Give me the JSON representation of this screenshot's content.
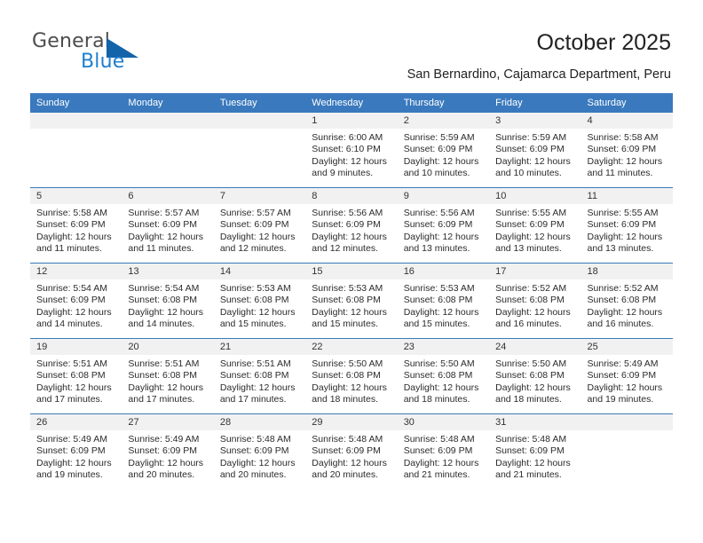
{
  "brand": {
    "name_top": "General",
    "name_bottom": "Blue",
    "accent_color": "#1464aa",
    "text_color": "#4d4d4d"
  },
  "header": {
    "title": "October 2025",
    "subtitle": "San Bernardino, Cajamarca Department, Peru"
  },
  "theme": {
    "header_band": "#3a79bd",
    "date_band": "#f1f1f1",
    "row_separator": "#3a79bd",
    "page_background": "#ffffff"
  },
  "calendar": {
    "weekday_headers": [
      "Sunday",
      "Monday",
      "Tuesday",
      "Wednesday",
      "Thursday",
      "Friday",
      "Saturday"
    ],
    "weeks": [
      [
        {
          "day": "",
          "sunrise": "",
          "sunset": "",
          "daylight_1": "",
          "daylight_2": ""
        },
        {
          "day": "",
          "sunrise": "",
          "sunset": "",
          "daylight_1": "",
          "daylight_2": ""
        },
        {
          "day": "",
          "sunrise": "",
          "sunset": "",
          "daylight_1": "",
          "daylight_2": ""
        },
        {
          "day": "1",
          "sunrise": "Sunrise: 6:00 AM",
          "sunset": "Sunset: 6:10 PM",
          "daylight_1": "Daylight: 12 hours",
          "daylight_2": "and 9 minutes."
        },
        {
          "day": "2",
          "sunrise": "Sunrise: 5:59 AM",
          "sunset": "Sunset: 6:09 PM",
          "daylight_1": "Daylight: 12 hours",
          "daylight_2": "and 10 minutes."
        },
        {
          "day": "3",
          "sunrise": "Sunrise: 5:59 AM",
          "sunset": "Sunset: 6:09 PM",
          "daylight_1": "Daylight: 12 hours",
          "daylight_2": "and 10 minutes."
        },
        {
          "day": "4",
          "sunrise": "Sunrise: 5:58 AM",
          "sunset": "Sunset: 6:09 PM",
          "daylight_1": "Daylight: 12 hours",
          "daylight_2": "and 11 minutes."
        }
      ],
      [
        {
          "day": "5",
          "sunrise": "Sunrise: 5:58 AM",
          "sunset": "Sunset: 6:09 PM",
          "daylight_1": "Daylight: 12 hours",
          "daylight_2": "and 11 minutes."
        },
        {
          "day": "6",
          "sunrise": "Sunrise: 5:57 AM",
          "sunset": "Sunset: 6:09 PM",
          "daylight_1": "Daylight: 12 hours",
          "daylight_2": "and 11 minutes."
        },
        {
          "day": "7",
          "sunrise": "Sunrise: 5:57 AM",
          "sunset": "Sunset: 6:09 PM",
          "daylight_1": "Daylight: 12 hours",
          "daylight_2": "and 12 minutes."
        },
        {
          "day": "8",
          "sunrise": "Sunrise: 5:56 AM",
          "sunset": "Sunset: 6:09 PM",
          "daylight_1": "Daylight: 12 hours",
          "daylight_2": "and 12 minutes."
        },
        {
          "day": "9",
          "sunrise": "Sunrise: 5:56 AM",
          "sunset": "Sunset: 6:09 PM",
          "daylight_1": "Daylight: 12 hours",
          "daylight_2": "and 13 minutes."
        },
        {
          "day": "10",
          "sunrise": "Sunrise: 5:55 AM",
          "sunset": "Sunset: 6:09 PM",
          "daylight_1": "Daylight: 12 hours",
          "daylight_2": "and 13 minutes."
        },
        {
          "day": "11",
          "sunrise": "Sunrise: 5:55 AM",
          "sunset": "Sunset: 6:09 PM",
          "daylight_1": "Daylight: 12 hours",
          "daylight_2": "and 13 minutes."
        }
      ],
      [
        {
          "day": "12",
          "sunrise": "Sunrise: 5:54 AM",
          "sunset": "Sunset: 6:09 PM",
          "daylight_1": "Daylight: 12 hours",
          "daylight_2": "and 14 minutes."
        },
        {
          "day": "13",
          "sunrise": "Sunrise: 5:54 AM",
          "sunset": "Sunset: 6:08 PM",
          "daylight_1": "Daylight: 12 hours",
          "daylight_2": "and 14 minutes."
        },
        {
          "day": "14",
          "sunrise": "Sunrise: 5:53 AM",
          "sunset": "Sunset: 6:08 PM",
          "daylight_1": "Daylight: 12 hours",
          "daylight_2": "and 15 minutes."
        },
        {
          "day": "15",
          "sunrise": "Sunrise: 5:53 AM",
          "sunset": "Sunset: 6:08 PM",
          "daylight_1": "Daylight: 12 hours",
          "daylight_2": "and 15 minutes."
        },
        {
          "day": "16",
          "sunrise": "Sunrise: 5:53 AM",
          "sunset": "Sunset: 6:08 PM",
          "daylight_1": "Daylight: 12 hours",
          "daylight_2": "and 15 minutes."
        },
        {
          "day": "17",
          "sunrise": "Sunrise: 5:52 AM",
          "sunset": "Sunset: 6:08 PM",
          "daylight_1": "Daylight: 12 hours",
          "daylight_2": "and 16 minutes."
        },
        {
          "day": "18",
          "sunrise": "Sunrise: 5:52 AM",
          "sunset": "Sunset: 6:08 PM",
          "daylight_1": "Daylight: 12 hours",
          "daylight_2": "and 16 minutes."
        }
      ],
      [
        {
          "day": "19",
          "sunrise": "Sunrise: 5:51 AM",
          "sunset": "Sunset: 6:08 PM",
          "daylight_1": "Daylight: 12 hours",
          "daylight_2": "and 17 minutes."
        },
        {
          "day": "20",
          "sunrise": "Sunrise: 5:51 AM",
          "sunset": "Sunset: 6:08 PM",
          "daylight_1": "Daylight: 12 hours",
          "daylight_2": "and 17 minutes."
        },
        {
          "day": "21",
          "sunrise": "Sunrise: 5:51 AM",
          "sunset": "Sunset: 6:08 PM",
          "daylight_1": "Daylight: 12 hours",
          "daylight_2": "and 17 minutes."
        },
        {
          "day": "22",
          "sunrise": "Sunrise: 5:50 AM",
          "sunset": "Sunset: 6:08 PM",
          "daylight_1": "Daylight: 12 hours",
          "daylight_2": "and 18 minutes."
        },
        {
          "day": "23",
          "sunrise": "Sunrise: 5:50 AM",
          "sunset": "Sunset: 6:08 PM",
          "daylight_1": "Daylight: 12 hours",
          "daylight_2": "and 18 minutes."
        },
        {
          "day": "24",
          "sunrise": "Sunrise: 5:50 AM",
          "sunset": "Sunset: 6:08 PM",
          "daylight_1": "Daylight: 12 hours",
          "daylight_2": "and 18 minutes."
        },
        {
          "day": "25",
          "sunrise": "Sunrise: 5:49 AM",
          "sunset": "Sunset: 6:09 PM",
          "daylight_1": "Daylight: 12 hours",
          "daylight_2": "and 19 minutes."
        }
      ],
      [
        {
          "day": "26",
          "sunrise": "Sunrise: 5:49 AM",
          "sunset": "Sunset: 6:09 PM",
          "daylight_1": "Daylight: 12 hours",
          "daylight_2": "and 19 minutes."
        },
        {
          "day": "27",
          "sunrise": "Sunrise: 5:49 AM",
          "sunset": "Sunset: 6:09 PM",
          "daylight_1": "Daylight: 12 hours",
          "daylight_2": "and 20 minutes."
        },
        {
          "day": "28",
          "sunrise": "Sunrise: 5:48 AM",
          "sunset": "Sunset: 6:09 PM",
          "daylight_1": "Daylight: 12 hours",
          "daylight_2": "and 20 minutes."
        },
        {
          "day": "29",
          "sunrise": "Sunrise: 5:48 AM",
          "sunset": "Sunset: 6:09 PM",
          "daylight_1": "Daylight: 12 hours",
          "daylight_2": "and 20 minutes."
        },
        {
          "day": "30",
          "sunrise": "Sunrise: 5:48 AM",
          "sunset": "Sunset: 6:09 PM",
          "daylight_1": "Daylight: 12 hours",
          "daylight_2": "and 21 minutes."
        },
        {
          "day": "31",
          "sunrise": "Sunrise: 5:48 AM",
          "sunset": "Sunset: 6:09 PM",
          "daylight_1": "Daylight: 12 hours",
          "daylight_2": "and 21 minutes."
        },
        {
          "day": "",
          "sunrise": "",
          "sunset": "",
          "daylight_1": "",
          "daylight_2": ""
        }
      ]
    ]
  }
}
